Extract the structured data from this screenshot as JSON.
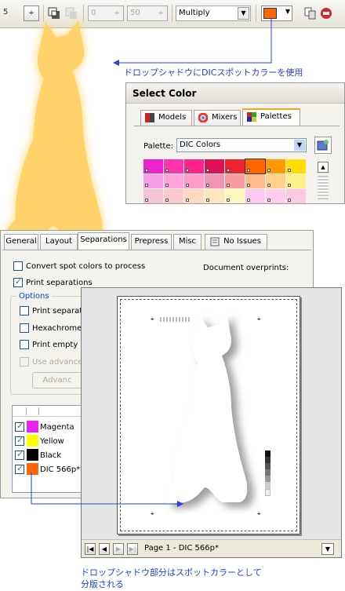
{
  "toolbar": {
    "partial_value": "5",
    "stepper_symbol": "÷",
    "offset_x": "0",
    "opacity": "50",
    "blend_mode": "Multiply",
    "shadow_color": "#ff6600"
  },
  "annotations": {
    "top": "ドロップシャドウにDICスポットカラーを使用",
    "bottom_line1": "ドロップシャドウ部分はスポットカラーとして",
    "bottom_line2": "分版される"
  },
  "select_color": {
    "title": "Select Color",
    "tabs": [
      "Models",
      "Mixers",
      "Palettes"
    ],
    "palette_label": "Palette:",
    "palette_value": "DIC Colors",
    "swatch_colors": [
      "#ee22cc",
      "#ff33aa",
      "#ff2288",
      "#dd1155",
      "#ee2233",
      "#ff6600",
      "#ff9900",
      "#ffdd00"
    ]
  },
  "print_dialog": {
    "tabs": [
      "General",
      "Layout",
      "Separations",
      "Prepress",
      "Misc",
      "No Issues"
    ],
    "convert_spot": "Convert spot colors to process",
    "print_separations": "Print separations",
    "document_overprints": "Document overprints:",
    "options_label": "Options",
    "opt1": "Print separat",
    "opt2": "Hexachrome",
    "opt3": "Print empty p",
    "opt4": "Use advance",
    "advanced_button": "Advanc",
    "plates": [
      {
        "name": "Magenta",
        "color": "#ee22ee"
      },
      {
        "name": "Yellow",
        "color": "#ffff00"
      },
      {
        "name": "Black",
        "color": "#000000"
      },
      {
        "name": "DIC 566p*",
        "color": "#ff6600"
      }
    ]
  },
  "preview": {
    "page_label": "Page 1 - DIC 566p*"
  },
  "colors": {
    "cat_fill": "#ffd36a",
    "annotation_blue": "#2243d3"
  }
}
